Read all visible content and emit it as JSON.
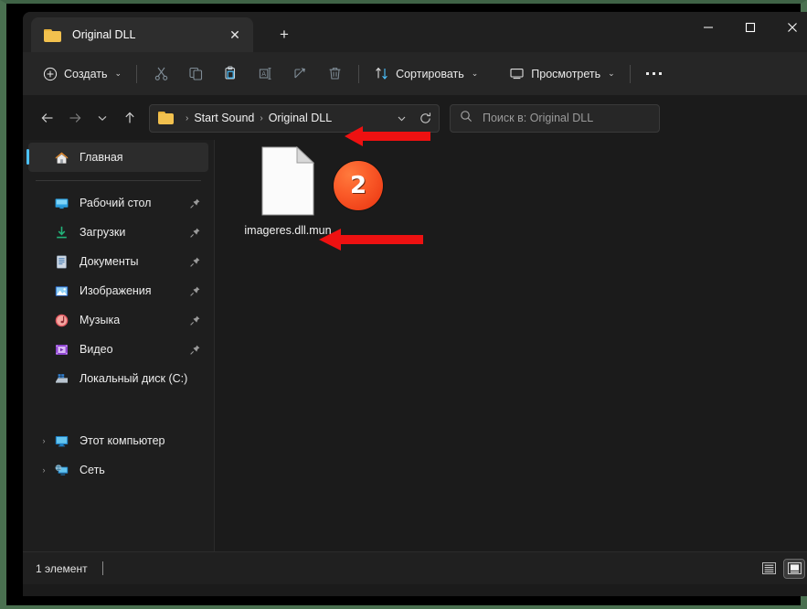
{
  "window": {
    "tab_title": "Original DLL",
    "tab_close_label": "✕",
    "new_tab_label": "+",
    "minimize_label": "minimize",
    "maximize_label": "maximize",
    "close_label": "close"
  },
  "toolbar": {
    "new_label": "Создать",
    "cut_label": "cut",
    "copy_label": "copy",
    "paste_label": "paste",
    "rename_label": "rename",
    "share_label": "share",
    "delete_label": "delete",
    "sort_label": "Сортировать",
    "view_label": "Просмотреть",
    "more_label": "…",
    "chevron": "⌄"
  },
  "address": {
    "back_label": "←",
    "forward_label": "→",
    "recent_label": "⌄",
    "up_label": "↑",
    "crumbs": [
      "Start Sound",
      "Original DLL"
    ],
    "crumb_separator": "›",
    "dropdown_label": "⌄",
    "refresh_label": "↻"
  },
  "search": {
    "placeholder": "Поиск в: Original DLL",
    "icon": "search-icon"
  },
  "sidebar": {
    "home": {
      "label": "Главная",
      "icon": "home-icon"
    },
    "quick_access": [
      {
        "label": "Рабочий стол",
        "icon": "desktop-icon",
        "pinned": true
      },
      {
        "label": "Загрузки",
        "icon": "downloads-icon",
        "pinned": true
      },
      {
        "label": "Документы",
        "icon": "documents-icon",
        "pinned": true
      },
      {
        "label": "Изображения",
        "icon": "pictures-icon",
        "pinned": true
      },
      {
        "label": "Музыка",
        "icon": "music-icon",
        "pinned": true
      },
      {
        "label": "Видео",
        "icon": "video-icon",
        "pinned": true
      },
      {
        "label": "Локальный диск (C:)",
        "icon": "drive-icon",
        "pinned": false
      }
    ],
    "tree": [
      {
        "label": "Этот компьютер",
        "icon": "this-pc-icon",
        "expander": "›"
      },
      {
        "label": "Сеть",
        "icon": "network-icon",
        "expander": "›"
      }
    ]
  },
  "content": {
    "files": [
      {
        "name": "imageres.dll.mun",
        "icon": "blank-page-icon"
      }
    ]
  },
  "annotations": {
    "badge_number": "2",
    "badge_color": "#f4541f",
    "arrow_color": "#ee1111",
    "arrow_breadcrumb": "red-arrow-left-breadcrumb",
    "arrow_filename": "red-arrow-left-filename"
  },
  "statusbar": {
    "item_count": "1 элемент",
    "details_view_label": "details-view",
    "large_icons_view_label": "large-icons-view"
  },
  "colors": {
    "titlebar": "#202020",
    "commandbar": "#262626",
    "sidebar": "#1e1e1e",
    "content": "#1b1b1b",
    "accent": "#4cc2ff",
    "frame": "#4a7050"
  }
}
